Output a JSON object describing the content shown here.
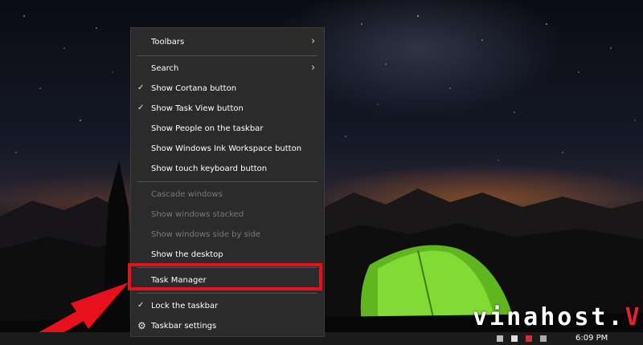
{
  "context_menu": {
    "items": [
      {
        "label": "Toolbars",
        "submenu": true,
        "checked": false,
        "enabled": true
      },
      {
        "label": "Search",
        "submenu": true,
        "checked": false,
        "enabled": true
      },
      {
        "label": "Show Cortana button",
        "submenu": false,
        "checked": true,
        "enabled": true
      },
      {
        "label": "Show Task View button",
        "submenu": false,
        "checked": true,
        "enabled": true
      },
      {
        "label": "Show People on the taskbar",
        "submenu": false,
        "checked": false,
        "enabled": true
      },
      {
        "label": "Show Windows Ink Workspace button",
        "submenu": false,
        "checked": false,
        "enabled": true
      },
      {
        "label": "Show touch keyboard button",
        "submenu": false,
        "checked": false,
        "enabled": true
      },
      {
        "label": "Cascade windows",
        "submenu": false,
        "checked": false,
        "enabled": false
      },
      {
        "label": "Show windows stacked",
        "submenu": false,
        "checked": false,
        "enabled": false
      },
      {
        "label": "Show windows side by side",
        "submenu": false,
        "checked": false,
        "enabled": false
      },
      {
        "label": "Show the desktop",
        "submenu": false,
        "checked": false,
        "enabled": true
      },
      {
        "label": "Task Manager",
        "submenu": false,
        "checked": false,
        "enabled": true,
        "highlighted": true
      },
      {
        "label": "Lock the taskbar",
        "submenu": false,
        "checked": true,
        "enabled": true
      },
      {
        "label": "Taskbar settings",
        "submenu": false,
        "checked": false,
        "enabled": true,
        "icon": "gear-icon"
      }
    ],
    "check_glyph": "✓",
    "chevron_glyph": "›",
    "gear_glyph": "⚙"
  },
  "taskbar": {
    "clock_time": "6:09 PM"
  },
  "watermark": {
    "text": "vinahost.",
    "accent": "V"
  },
  "colors": {
    "menu_bg": "#2b2b2b",
    "highlight_border": "#e8101a",
    "arrow": "#e8101a",
    "disabled_text": "#7a7a7a"
  }
}
